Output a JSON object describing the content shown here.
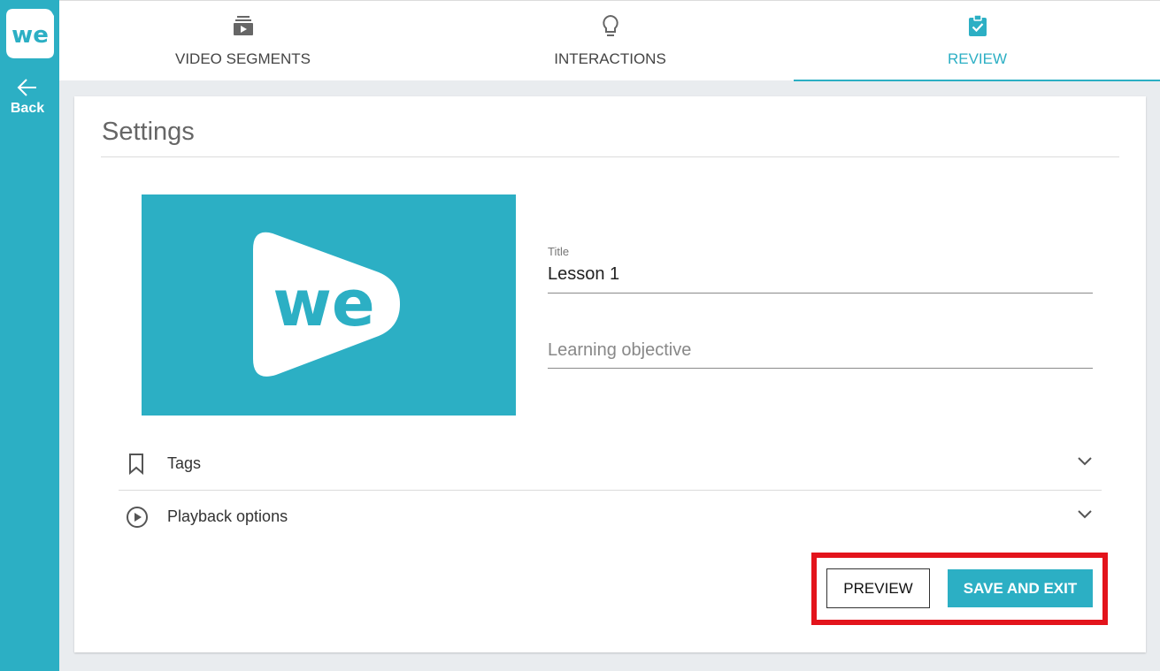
{
  "brand": {
    "logo_text": "we",
    "accent_color": "#2cafc4"
  },
  "sidebar": {
    "back_label": "Back",
    "back_icon": "arrow-left-icon"
  },
  "tabs": [
    {
      "label": "VIDEO SEGMENTS",
      "icon": "video-stack-icon",
      "active": false
    },
    {
      "label": "INTERACTIONS",
      "icon": "lightbulb-icon",
      "active": false
    },
    {
      "label": "REVIEW",
      "icon": "clipboard-check-icon",
      "active": true
    }
  ],
  "settings": {
    "title": "Settings",
    "thumbnail_logo_text": "we",
    "title_field": {
      "label": "Title",
      "value": "Lesson 1"
    },
    "objective_field": {
      "placeholder": "Learning objective"
    },
    "accordions": [
      {
        "label": "Tags",
        "icon": "bookmark-icon"
      },
      {
        "label": "Playback options",
        "icon": "play-circle-icon"
      }
    ]
  },
  "actions": {
    "preview_label": "PREVIEW",
    "save_label": "SAVE AND EXIT",
    "highlight_color": "#e3141c"
  }
}
